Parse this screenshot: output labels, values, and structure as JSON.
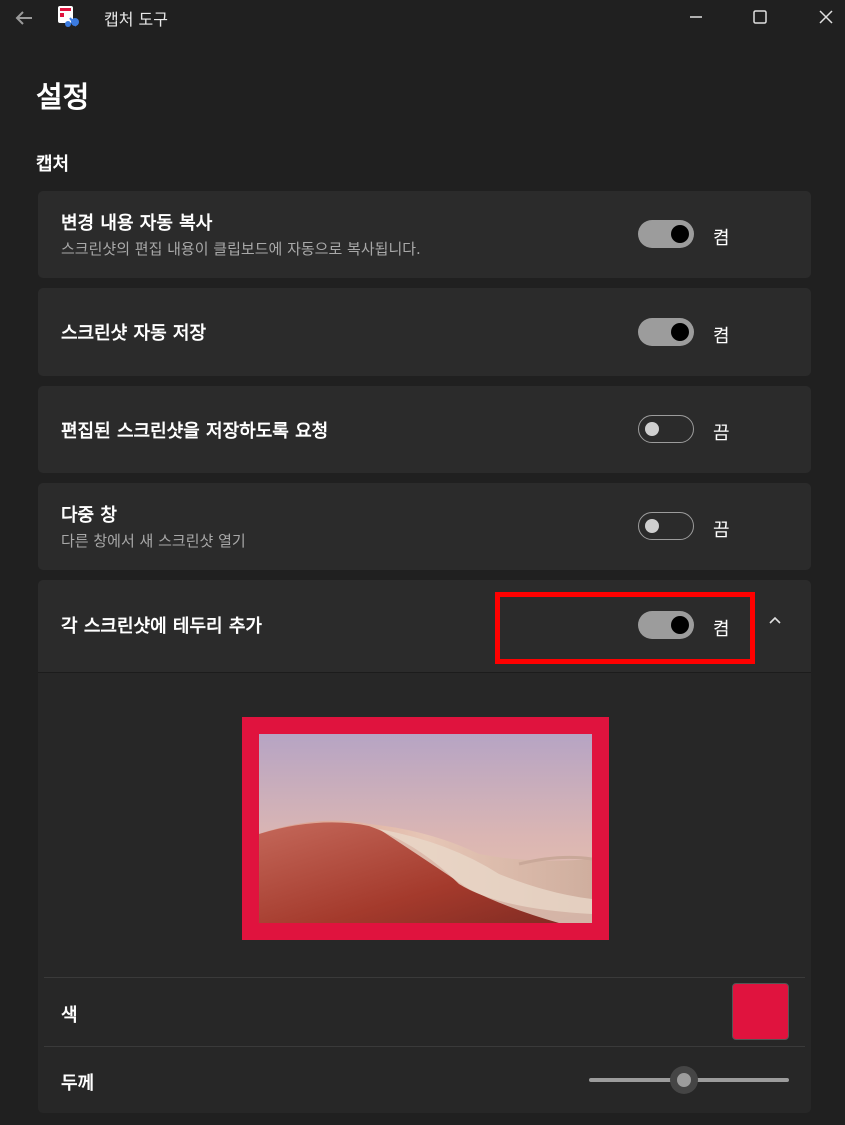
{
  "window": {
    "title": "캡처 도구",
    "back_icon": "back-arrow-icon",
    "app_icon": "snipping-tool-icon",
    "controls": [
      "minimize-icon",
      "maximize-icon",
      "close-icon"
    ]
  },
  "page": {
    "title": "설정"
  },
  "section": {
    "label": "캡처"
  },
  "settings": [
    {
      "title": "변경 내용 자동 복사",
      "subtitle": "스크린샷의 편집 내용이 클립보드에 자동으로 복사됩니다.",
      "toggle_on": true,
      "state_label": "켬"
    },
    {
      "title": "스크린샷 자동 저장",
      "toggle_on": true,
      "state_label": "켬"
    },
    {
      "title": "편집된 스크린샷을 저장하도록 요청",
      "toggle_on": false,
      "state_label": "끔"
    },
    {
      "title": "다중 창",
      "subtitle": "다른 창에서 새 스크린샷 열기",
      "toggle_on": false,
      "state_label": "끔"
    },
    {
      "title": "각 스크린샷에 테두리 추가",
      "toggle_on": true,
      "state_label": "켬",
      "expanded": true
    }
  ],
  "border_options": {
    "color_label": "색",
    "color_value": "#e0133e",
    "thickness_label": "두께",
    "thickness_fraction": 0.48
  },
  "colors": {
    "background": "#202020",
    "card": "#2b2b2b",
    "accent_border": "#e0133e",
    "highlight": "#ff0000"
  }
}
